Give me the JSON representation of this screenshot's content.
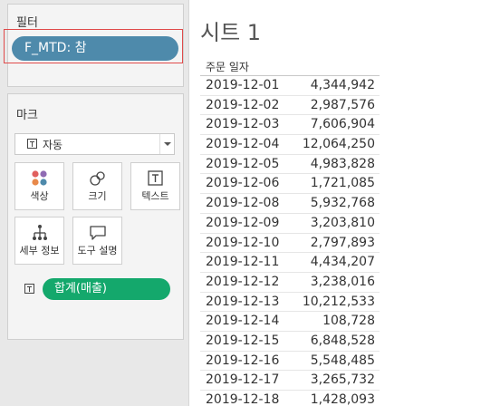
{
  "filters": {
    "title": "필터",
    "pill_label": "F_MTD: 참"
  },
  "marks": {
    "title": "마크",
    "mark_type": "자동",
    "buttons": [
      {
        "label": "색상",
        "icon": "color-dots-icon"
      },
      {
        "label": "크기",
        "icon": "size-circles-icon"
      },
      {
        "label": "텍스트",
        "icon": "text-T-icon"
      },
      {
        "label": "세부 정보",
        "icon": "hierarchy-icon"
      },
      {
        "label": "도구 설명",
        "icon": "speech-bubble-icon"
      }
    ],
    "measure_pill": "합계(매출)"
  },
  "sheet": {
    "title": "시트 1",
    "column_header": "주문 일자",
    "rows": [
      {
        "date": "2019-12-01",
        "value": "4,344,942"
      },
      {
        "date": "2019-12-02",
        "value": "2,987,576"
      },
      {
        "date": "2019-12-03",
        "value": "7,606,904"
      },
      {
        "date": "2019-12-04",
        "value": "12,064,250"
      },
      {
        "date": "2019-12-05",
        "value": "4,983,828"
      },
      {
        "date": "2019-12-06",
        "value": "1,721,085"
      },
      {
        "date": "2019-12-08",
        "value": "5,932,768"
      },
      {
        "date": "2019-12-09",
        "value": "3,203,810"
      },
      {
        "date": "2019-12-10",
        "value": "2,797,893"
      },
      {
        "date": "2019-12-11",
        "value": "4,434,207"
      },
      {
        "date": "2019-12-12",
        "value": "3,238,016"
      },
      {
        "date": "2019-12-13",
        "value": "10,212,533"
      },
      {
        "date": "2019-12-14",
        "value": "108,728"
      },
      {
        "date": "2019-12-15",
        "value": "6,848,528"
      },
      {
        "date": "2019-12-16",
        "value": "5,548,485"
      },
      {
        "date": "2019-12-17",
        "value": "3,265,732"
      },
      {
        "date": "2019-12-18",
        "value": "1,428,093"
      }
    ]
  },
  "colors": {
    "filter_pill": "#4e8aab",
    "measure_pill": "#14a86c",
    "highlight": "#e04a4a"
  }
}
